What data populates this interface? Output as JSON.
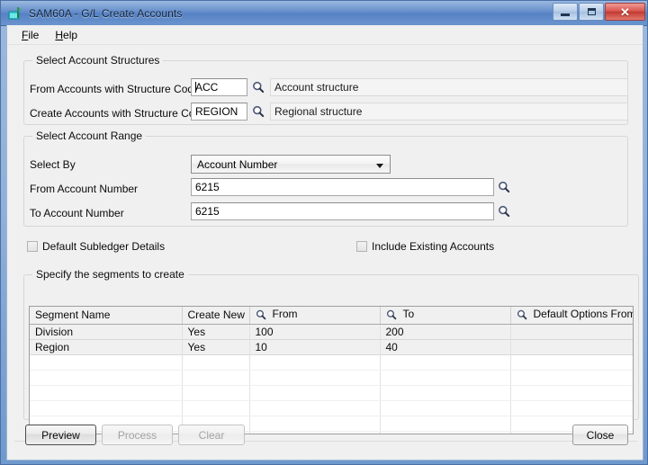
{
  "window": {
    "title": "SAM60A - G/L Create Accounts",
    "icon": "app-icon",
    "controls": {
      "minimize": "–",
      "maximize": "□",
      "close": "✕"
    }
  },
  "menu": {
    "items": [
      {
        "label": "File",
        "accel": "F"
      },
      {
        "label": "Help",
        "accel": "H"
      }
    ]
  },
  "structures_group": {
    "legend": "Select Account Structures",
    "from_label": "From Accounts with Structure Code",
    "from_value": "ACC",
    "from_desc": "Account structure",
    "create_label": "Create Accounts with Structure Code",
    "create_value": "REGION",
    "create_desc": "Regional structure",
    "finder_icon": "magnifier-icon"
  },
  "range_group": {
    "legend": "Select Account Range",
    "select_by_label": "Select By",
    "select_by_value": "Account Number",
    "select_by_options": [
      "Account Number"
    ],
    "from_label": "From Account Number",
    "from_value": "6215",
    "to_label": "To Account Number",
    "to_value": "6215",
    "finder_icon": "magnifier-icon"
  },
  "options": {
    "default_subledger": {
      "label": "Default Subledger Details",
      "checked": false
    },
    "include_existing": {
      "label": "Include Existing Accounts",
      "checked": false
    }
  },
  "segments_group": {
    "legend": "Specify the segments to create",
    "columns": [
      {
        "label": "Segment Name",
        "icon": ""
      },
      {
        "label": "Create New",
        "icon": ""
      },
      {
        "label": "From",
        "icon": "magnifier-icon"
      },
      {
        "label": "To",
        "icon": "magnifier-icon"
      },
      {
        "label": "Default Options From",
        "icon": "magnifier-icon"
      }
    ],
    "rows": [
      {
        "segment_name": "Division",
        "create_new": "Yes",
        "from": "100",
        "to": "200",
        "default_options_from": ""
      },
      {
        "segment_name": "Region",
        "create_new": "Yes",
        "from": "10",
        "to": "40",
        "default_options_from": ""
      }
    ],
    "empty_row_count": 6
  },
  "buttons": {
    "preview": {
      "label": "Preview",
      "accel": "v",
      "state": "default"
    },
    "process": {
      "label": "Process",
      "accel": "P",
      "state": "disabled"
    },
    "clear": {
      "label": "Clear",
      "accel": "l",
      "state": "disabled"
    },
    "close": {
      "label": "Close",
      "accel": "C",
      "state": "normal"
    }
  },
  "colors": {
    "titlebar": "#5c86c6",
    "client": "#f0f0f0",
    "grid_row": "#f0f0f0",
    "close_button": "#d9534e"
  }
}
